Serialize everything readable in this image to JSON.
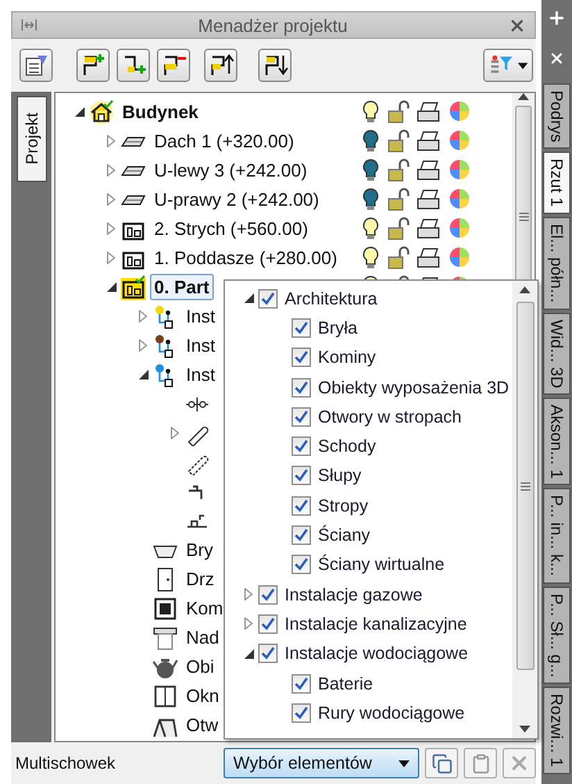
{
  "panel": {
    "title": "Menadżer projektu"
  },
  "left_tabs": [
    {
      "label": "Projekt",
      "selected": true
    }
  ],
  "tree": [
    {
      "label": "Budynek",
      "kind": "building",
      "active": true,
      "selected": false,
      "expanded": true,
      "light_on": true,
      "children": [
        {
          "label": "Dach 1 (+320.00)",
          "kind": "roof",
          "selected": false,
          "expanded": false,
          "light_on": false
        },
        {
          "label": "U-lewy 3 (+242.00)",
          "kind": "roof",
          "selected": false,
          "expanded": false,
          "light_on": false
        },
        {
          "label": "U-prawy 2 (+242.00)",
          "kind": "roof",
          "selected": false,
          "expanded": false,
          "light_on": false
        },
        {
          "label": "2. Strych (+560.00)",
          "kind": "storey",
          "selected": false,
          "expanded": false,
          "light_on": true
        },
        {
          "label": "1. Poddasze (+280.00)",
          "kind": "storey",
          "selected": false,
          "expanded": false,
          "light_on": true
        },
        {
          "label": "0. Part",
          "kind": "storey",
          "active": true,
          "selected": true,
          "expanded": true,
          "light_on": true,
          "children": [
            {
              "label": "Inst",
              "kind": "installation",
              "color": "#f5d800",
              "selected": false,
              "expanded": false
            },
            {
              "label": "Inst",
              "kind": "installation",
              "color": "#7a3f1c",
              "selected": false,
              "expanded": false
            },
            {
              "label": "Inst",
              "kind": "installation",
              "color": "#1e90e0",
              "selected": false,
              "expanded": true,
              "children": [
                {
                  "kind": "valve",
                  "selected": false
                },
                {
                  "kind": "pipe",
                  "selected": false,
                  "expanded": false
                },
                {
                  "kind": "pipe-dashed",
                  "selected": false
                },
                {
                  "kind": "tap",
                  "selected": false
                },
                {
                  "kind": "fitting",
                  "selected": false
                }
              ]
            },
            {
              "label": "Bry",
              "kind": "solid",
              "selected": false
            },
            {
              "label": "Drz",
              "kind": "door",
              "selected": false
            },
            {
              "label": "Kom",
              "kind": "chimney",
              "selected": false
            },
            {
              "label": "Nad",
              "kind": "lintel",
              "selected": false
            },
            {
              "label": "Obi",
              "kind": "object",
              "selected": false
            },
            {
              "label": "Okn",
              "kind": "window",
              "selected": false
            },
            {
              "label": "Otw",
              "kind": "opening",
              "selected": false
            }
          ]
        }
      ]
    }
  ],
  "filter_popup": [
    {
      "label": "Architektura",
      "checked": true,
      "expanded": true,
      "children": [
        {
          "label": "Bryła",
          "checked": true
        },
        {
          "label": "Kominy",
          "checked": true
        },
        {
          "label": "Obiekty wyposażenia 3D",
          "checked": true
        },
        {
          "label": "Otwory w stropach",
          "checked": true
        },
        {
          "label": "Schody",
          "checked": true
        },
        {
          "label": "Słupy",
          "checked": true
        },
        {
          "label": "Stropy",
          "checked": true
        },
        {
          "label": "Ściany",
          "checked": true
        },
        {
          "label": "Ściany wirtualne",
          "checked": true
        }
      ]
    },
    {
      "label": "Instalacje gazowe",
      "checked": true,
      "expanded": false
    },
    {
      "label": "Instalacje kanalizacyjne",
      "checked": true,
      "expanded": false
    },
    {
      "label": "Instalacje wodociągowe",
      "checked": true,
      "expanded": true,
      "children": [
        {
          "label": "Baterie",
          "checked": true
        },
        {
          "label": "Rury wodociągowe",
          "checked": true
        }
      ]
    }
  ],
  "status_bar": {
    "label": "Multischowek",
    "dropdown": "Wybór elementów"
  },
  "side_tabs": [
    {
      "label": "Podrys",
      "selected": false
    },
    {
      "label": "Rzut 1",
      "selected": true
    },
    {
      "label": "El... półn...",
      "selected": false
    },
    {
      "label": "Wid... 3D",
      "selected": false
    },
    {
      "label": "Akson... 1",
      "selected": false
    },
    {
      "label": "P... in... k...",
      "selected": false
    },
    {
      "label": "P... Sł... g...",
      "selected": false
    },
    {
      "label": "Rozwi... 1",
      "selected": false
    }
  ]
}
